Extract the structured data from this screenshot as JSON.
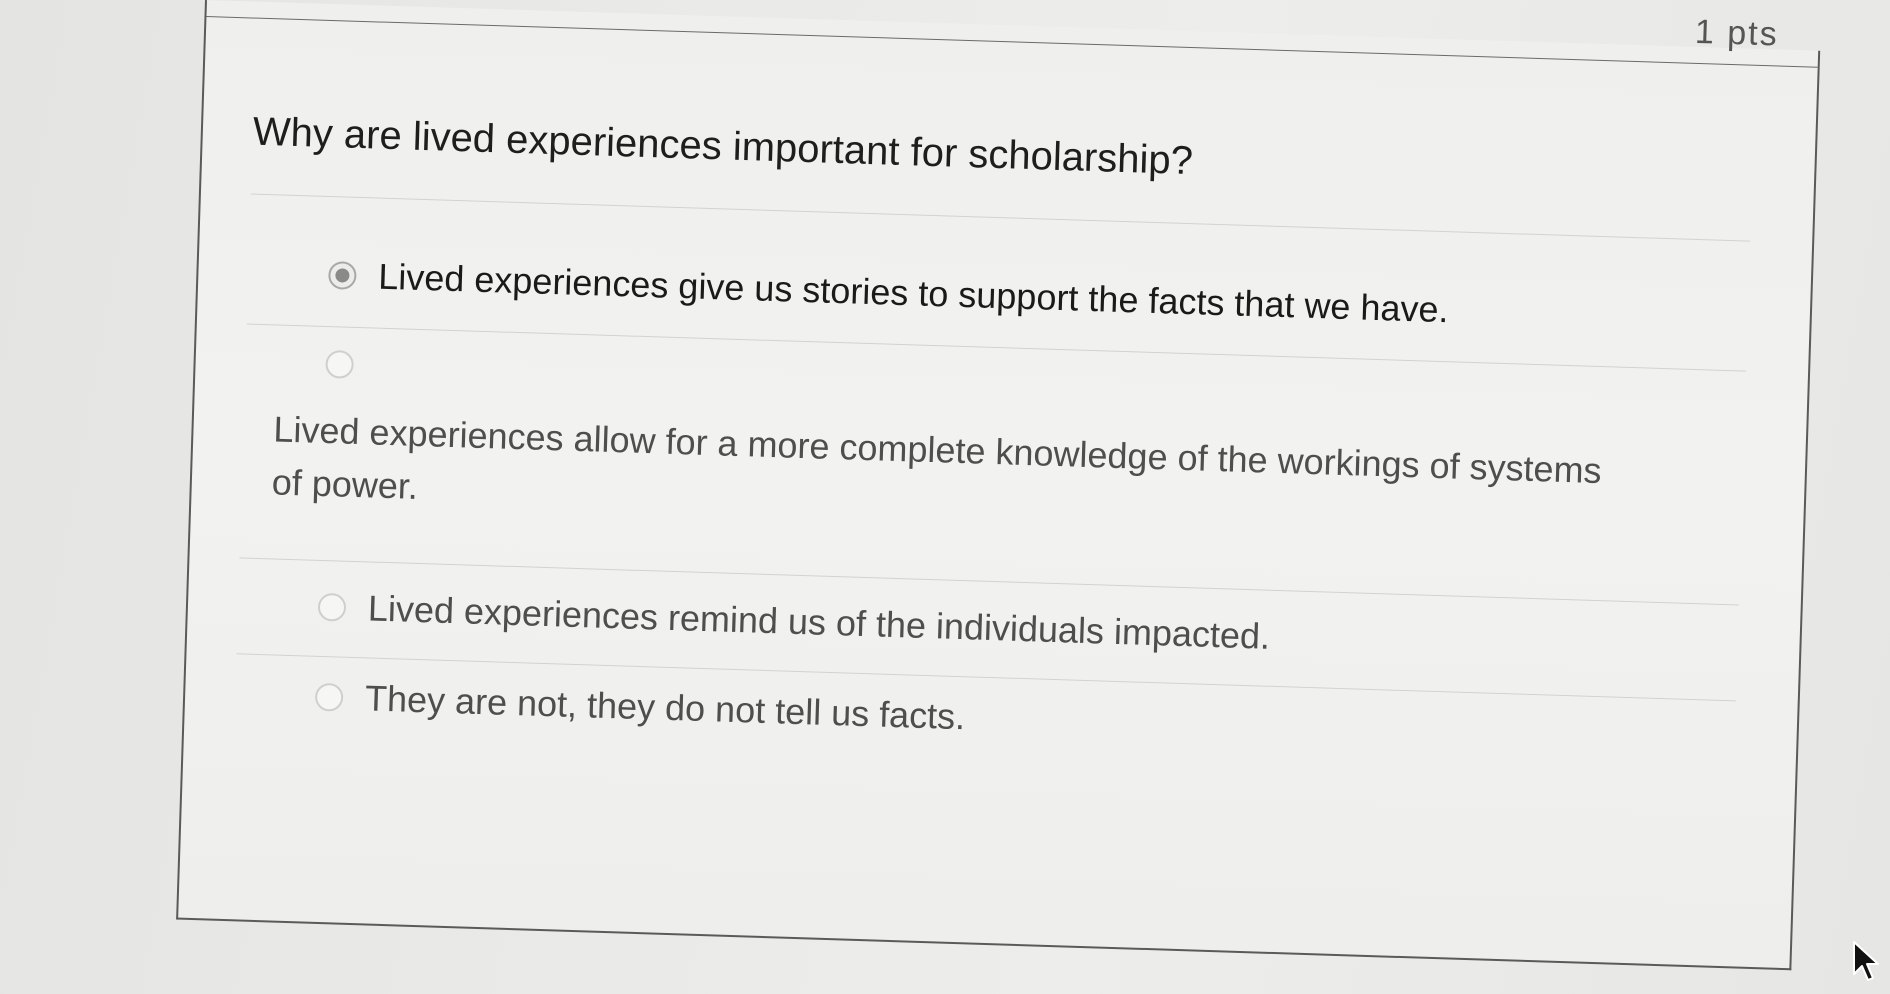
{
  "quiz": {
    "points_label": "1 pts",
    "question": "Why are lived experiences important for scholarship?",
    "answers": [
      {
        "label": "Lived experiences give us stories to support the facts that we have.",
        "selected": true
      },
      {
        "label": "Lived experiences allow for a more complete knowledge of the workings of systems of power.",
        "selected": false
      },
      {
        "label": "Lived experiences remind us of the individuals impacted.",
        "selected": false
      },
      {
        "label": "They are not, they do not tell us facts.",
        "selected": false
      }
    ]
  },
  "colors": {
    "background": "#e9e9e7",
    "card": "#f1f1ef",
    "card_border": "#5a5a5a",
    "question_text": "#1e1e1e",
    "answer_text": "#4e4e4e",
    "divider": "#d2d2d0"
  },
  "icons": {
    "radio_selected": "radio-selected-icon",
    "radio_unselected": "radio-unselected-icon",
    "cursor": "mouse-pointer-icon"
  }
}
